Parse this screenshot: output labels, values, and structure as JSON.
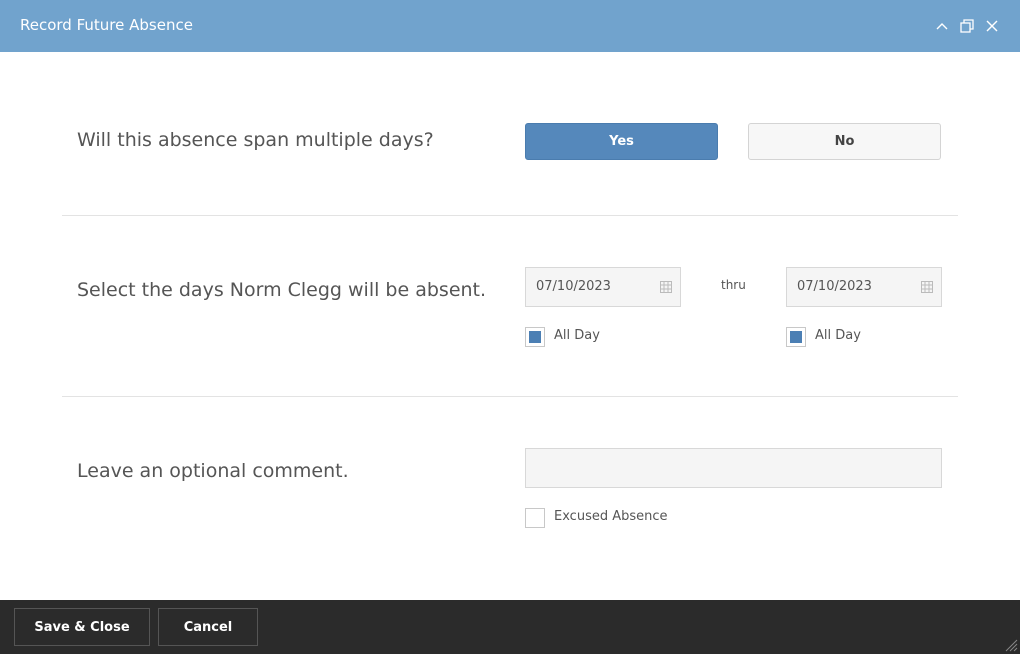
{
  "window": {
    "title": "Record Future Absence",
    "controls": [
      "chevron-up-icon",
      "restore-icon",
      "close-icon"
    ]
  },
  "colors": {
    "titlebar": "#71a3cd",
    "primary_button": "#5588bb",
    "checkbox_fill": "#4b7fb4",
    "footer": "#2b2b2b"
  },
  "section_span": {
    "question": "Will this absence span multiple days?",
    "yes_label": "Yes",
    "no_label": "No",
    "selected": "Yes"
  },
  "section_days": {
    "question": "Select the days Norm Clegg will be absent.",
    "start_date": "07/10/2023",
    "thru_label": "thru",
    "end_date": "07/10/2023",
    "start_all_day": {
      "label": "All Day",
      "checked": true
    },
    "end_all_day": {
      "label": "All Day",
      "checked": true
    }
  },
  "section_comment": {
    "question": "Leave an optional comment.",
    "comment_value": "",
    "excused": {
      "label": "Excused Absence",
      "checked": false
    }
  },
  "footer": {
    "save_label": "Save & Close",
    "cancel_label": "Cancel"
  }
}
